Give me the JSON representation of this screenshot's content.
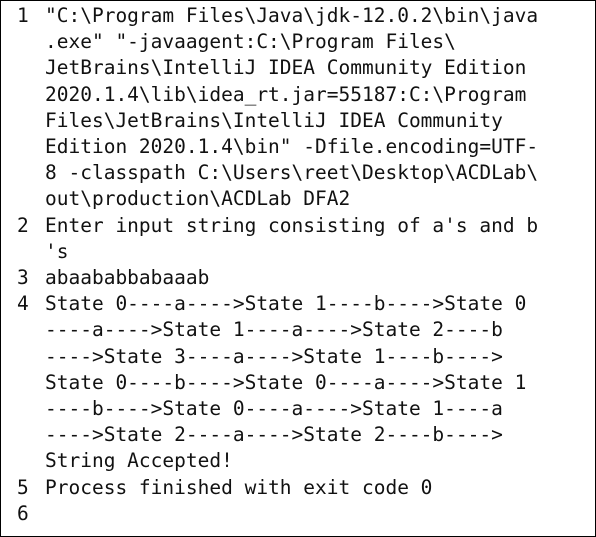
{
  "console": {
    "lines": [
      {
        "number": "1",
        "rows": [
          "\"C:\\Program Files\\Java\\jdk-12.0.2\\bin\\java",
          ".exe\" \"-javaagent:C:\\Program Files\\",
          "JetBrains\\IntelliJ IDEA Community Edition",
          "2020.1.4\\lib\\idea_rt.jar=55187:C:\\Program",
          "Files\\JetBrains\\IntelliJ IDEA Community",
          "Edition 2020.1.4\\bin\" -Dfile.encoding=UTF-",
          "8 -classpath C:\\Users\\reet\\Desktop\\ACDLab\\",
          "out\\production\\ACDLab DFA2"
        ]
      },
      {
        "number": "2",
        "rows": [
          "Enter input string consisting of a's and b",
          "'s"
        ]
      },
      {
        "number": "3",
        "rows": [
          "abaababbabaaab"
        ]
      },
      {
        "number": "4",
        "rows": [
          "State 0----a---->State 1----b---->State 0",
          "----a---->State 1----a---->State 2----b",
          "---->State 3----a---->State 1----b---->",
          "State 0----b---->State 0----a---->State 1",
          "----b---->State 0----a---->State 1----a",
          "---->State 2----a---->State 2----b---->",
          "String Accepted!"
        ]
      },
      {
        "number": "5",
        "rows": [
          "Process finished with exit code 0"
        ]
      },
      {
        "number": "6",
        "rows": [
          ""
        ]
      }
    ]
  }
}
